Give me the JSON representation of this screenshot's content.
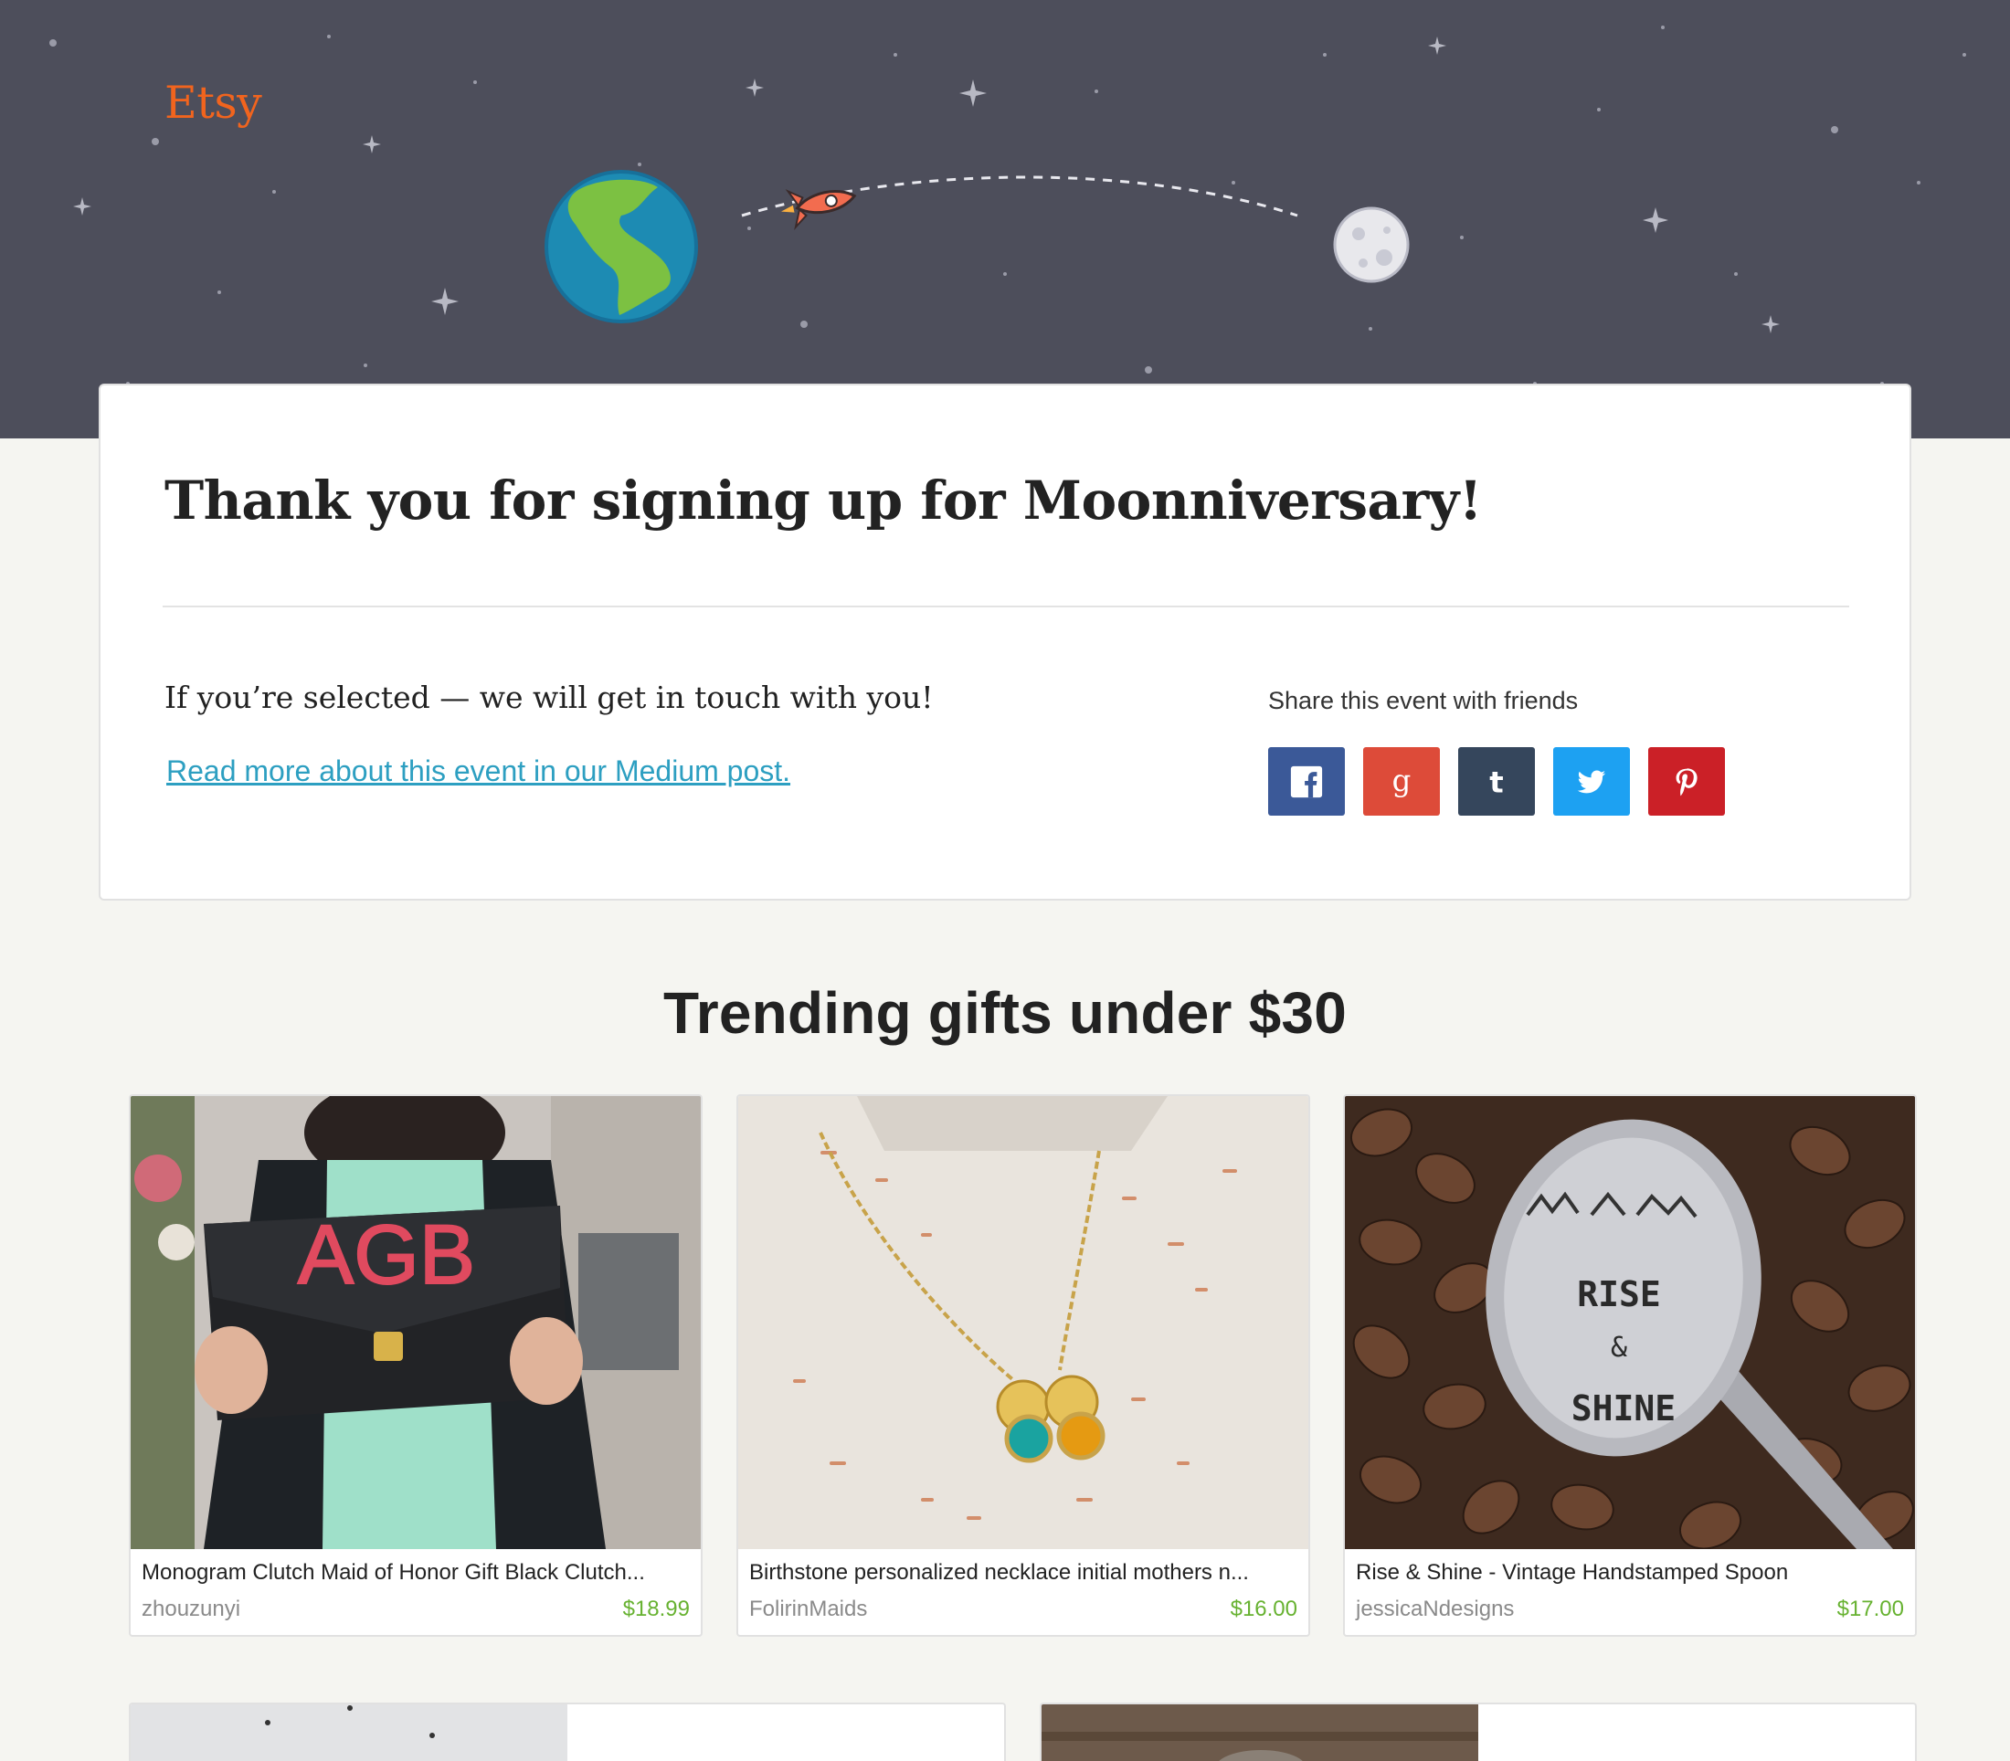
{
  "brand": {
    "logo_text": "Etsy",
    "accent_color": "#f1641e"
  },
  "hero": {
    "illustrations": [
      "earth-icon",
      "rocket-icon",
      "moon-icon"
    ],
    "background_color": "#4d4e5b"
  },
  "confirmation": {
    "heading": "Thank you for signing up for Moonniversary!",
    "selected_message": "If you’re selected — we will get in touch with you!",
    "medium_link": "Read more about this event in our Medium post."
  },
  "share": {
    "label": "Share this event with friends",
    "buttons": [
      {
        "network": "Facebook",
        "icon": "facebook-icon",
        "color": "#3b5998"
      },
      {
        "network": "Google",
        "icon": "google-icon",
        "color": "#dd4b39"
      },
      {
        "network": "Tumblr",
        "icon": "tumblr-icon",
        "color": "#35465c"
      },
      {
        "network": "Twitter",
        "icon": "twitter-icon",
        "color": "#1da1f2"
      },
      {
        "network": "Pinterest",
        "icon": "pinterest-icon",
        "color": "#cb2027"
      }
    ]
  },
  "trending": {
    "title": "Trending gifts under $30",
    "items": [
      {
        "title": "Monogram Clutch Maid of Honor Gift Black Clutch...",
        "shop": "zhouzunyi",
        "price": "$18.99",
        "image_text": "AGB"
      },
      {
        "title": "Birthstone personalized necklace initial mothers n...",
        "shop": "FolirinMaids",
        "price": "$16.00"
      },
      {
        "title": "Rise & Shine - Vintage Handstamped Spoon",
        "shop": "jessicaNdesigns",
        "price": "$17.00",
        "image_text_1": "RISE",
        "image_text_2": "&",
        "image_text_3": "SHINE"
      }
    ]
  }
}
